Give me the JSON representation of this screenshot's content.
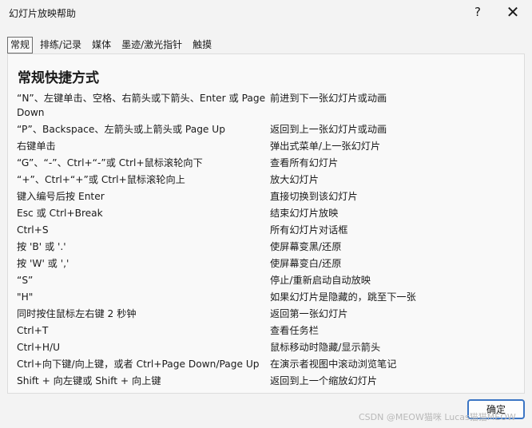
{
  "window": {
    "title": "幻灯片放映帮助",
    "help_glyph": "?",
    "close_glyph": "✕"
  },
  "tabs": [
    {
      "label": "常规",
      "active": true
    },
    {
      "label": "排练/记录",
      "active": false
    },
    {
      "label": "媒体",
      "active": false
    },
    {
      "label": "墨迹/激光指针",
      "active": false
    },
    {
      "label": "触摸",
      "active": false
    }
  ],
  "panel": {
    "heading": "常规快捷方式",
    "shortcuts": [
      {
        "key": "“N”、左键单击、空格、右箭头或下箭头、Enter 或 Page Down",
        "desc": "前进到下一张幻灯片或动画"
      },
      {
        "key": "“P”、Backspace、左箭头或上箭头或 Page Up",
        "desc": "返回到上一张幻灯片或动画"
      },
      {
        "key": "右键单击",
        "desc": "弹出式菜单/上一张幻灯片"
      },
      {
        "key": "“G”、“-”、Ctrl+“-”或 Ctrl+鼠标滚轮向下",
        "desc": "查看所有幻灯片"
      },
      {
        "key": "“+”、Ctrl+“+”或 Ctrl+鼠标滚轮向上",
        "desc": "放大幻灯片"
      },
      {
        "key": "键入编号后按 Enter",
        "desc": "直接切换到该幻灯片"
      },
      {
        "key": "Esc 或 Ctrl+Break",
        "desc": "结束幻灯片放映"
      },
      {
        "key": "Ctrl+S",
        "desc": "所有幻灯片对话框"
      },
      {
        "key": "按 'B' 或 '.'",
        "desc": "使屏幕变黑/还原"
      },
      {
        "key": "按 'W' 或 ','",
        "desc": "使屏幕变白/还原"
      },
      {
        "key": "“S”",
        "desc": "停止/重新启动自动放映"
      },
      {
        "key": "\"H\"",
        "desc": "如果幻灯片是隐藏的，跳至下一张"
      },
      {
        "key": "同时按住鼠标左右键 2 秒钟",
        "desc": "返回第一张幻灯片"
      },
      {
        "key": "Ctrl+T",
        "desc": "查看任务栏"
      },
      {
        "key": "Ctrl+H/U",
        "desc": "鼠标移动时隐藏/显示箭头"
      },
      {
        "key": "Ctrl+向下键/向上键，或者 Ctrl+Page Down/Page Up",
        "desc": "在演示者视图中滚动浏览笔记"
      },
      {
        "key": "Shift + 向左键或 Shift + 向上键",
        "desc": "返回到上一个缩放幻灯片"
      }
    ]
  },
  "buttons": {
    "ok_label": "确定"
  },
  "watermark": "CSDN @MEOW猫咪 Lucas猫猫MEOW"
}
